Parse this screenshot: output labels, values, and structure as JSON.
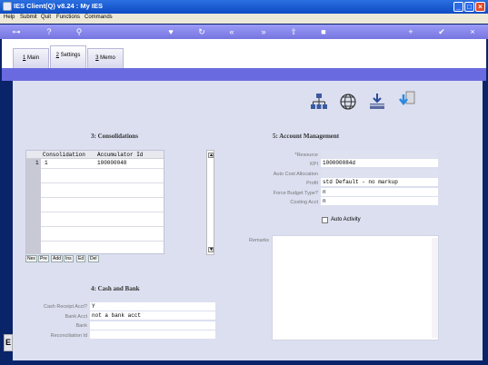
{
  "window": {
    "title": "IES Client(Q) v8.24 : My IES"
  },
  "menu": [
    "Help",
    "Submit",
    "Quit",
    "Functions",
    "Commands"
  ],
  "toolbar_icons": [
    "key-icon",
    "help-icon",
    "search-icon",
    "heart-icon",
    "refresh-icon",
    "back-icon",
    "forward-icon",
    "upload-icon",
    "stop-icon",
    "add-icon",
    "check-icon",
    "close-icon"
  ],
  "tabs": [
    {
      "key": "1",
      "label": " Main"
    },
    {
      "key": "2",
      "label": " Settings"
    },
    {
      "key": "3",
      "label": " Memo"
    }
  ],
  "consolidations": {
    "title": "3: Consolidations",
    "columns": [
      "Consolidation",
      "Accumulator Id"
    ],
    "rows": [
      {
        "num": "1",
        "consolidation": "1",
        "accumulator_id": "100000048"
      }
    ],
    "buttons": [
      "Nex",
      "Pre",
      "Add",
      "Ins",
      "Ed",
      "Del"
    ]
  },
  "cash_bank": {
    "title": "4: Cash and Bank",
    "fields": [
      {
        "label": "Cash Receipt Acct?",
        "value": "Y"
      },
      {
        "label": "Bank Acct",
        "value": "not a bank acct"
      },
      {
        "label": "Bank",
        "value": ""
      },
      {
        "label": "Reconciliation Id",
        "value": ""
      }
    ]
  },
  "account_mgmt": {
    "title": "5: Account Management",
    "fields": [
      {
        "label": "*Resource",
        "value": ""
      },
      {
        "label": "KPI",
        "value": "100000084d"
      },
      {
        "label": "Auto Cost Allocation",
        "value": ""
      },
      {
        "label": "Profit",
        "value": "std Default - no markup"
      },
      {
        "label": "Force Budget Type?",
        "value": "n"
      },
      {
        "label": "Costing Acct",
        "value": "n"
      }
    ],
    "auto_activity_label": "Auto Activity",
    "remarks_label": "Remarks"
  },
  "side_button": "E",
  "colors": {
    "titlebar": "#0d4bc4",
    "toolbar": "#7575e0",
    "content": "#dbdfef",
    "tabband": "#6a6ae0"
  }
}
